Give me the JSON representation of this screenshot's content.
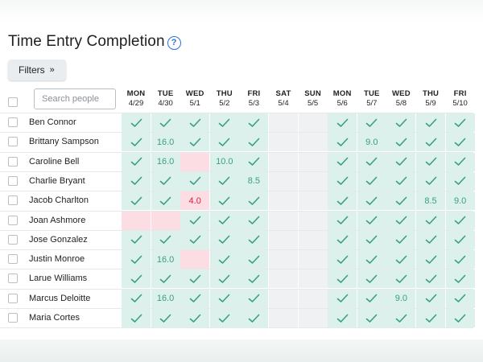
{
  "page": {
    "title": "Time Entry Completion",
    "help": "?",
    "filters_label": "Filters",
    "filters_chevron": "»",
    "search_placeholder": "Search people"
  },
  "colors": {
    "complete": "#ddf1ec",
    "check": "#3a9d84",
    "missing": "#fbdde3",
    "missing_text": "#d0223f",
    "weekend": "#f0f1f2",
    "accent": "#2f6fd6"
  },
  "days": [
    {
      "name": "MON",
      "date": "4/29",
      "weekend": false
    },
    {
      "name": "TUE",
      "date": "4/30",
      "weekend": false
    },
    {
      "name": "WED",
      "date": "5/1",
      "weekend": false
    },
    {
      "name": "THU",
      "date": "5/2",
      "weekend": false
    },
    {
      "name": "FRI",
      "date": "5/3",
      "weekend": false
    },
    {
      "name": "SAT",
      "date": "5/4",
      "weekend": true
    },
    {
      "name": "SUN",
      "date": "5/5",
      "weekend": true
    },
    {
      "name": "MON",
      "date": "5/6",
      "weekend": false
    },
    {
      "name": "TUE",
      "date": "5/7",
      "weekend": false
    },
    {
      "name": "WED",
      "date": "5/8",
      "weekend": false
    },
    {
      "name": "THU",
      "date": "5/9",
      "weekend": false
    },
    {
      "name": "FRI",
      "date": "5/10",
      "weekend": false
    }
  ],
  "people": [
    {
      "name": "Ben Connor",
      "cells": [
        "c",
        "c",
        "c",
        "c",
        "c",
        "-",
        "-",
        "c",
        "c",
        "c",
        "c",
        "c"
      ]
    },
    {
      "name": "Brittany Sampson",
      "cells": [
        "c",
        "16.0",
        "c",
        "c",
        "c",
        "-",
        "-",
        "c",
        "9.0",
        "c",
        "c",
        "c"
      ]
    },
    {
      "name": "Caroline Bell",
      "cells": [
        "c",
        "16.0",
        "x",
        "10.0",
        "c",
        "-",
        "-",
        "c",
        "c",
        "c",
        "c",
        "c"
      ]
    },
    {
      "name": "Charlie Bryant",
      "cells": [
        "c",
        "c",
        "c",
        "c",
        "8.5",
        "-",
        "-",
        "c",
        "c",
        "c",
        "c",
        "c"
      ]
    },
    {
      "name": "Jacob Charlton",
      "cells": [
        "c",
        "c",
        "x:4.0",
        "c",
        "c",
        "-",
        "-",
        "c",
        "c",
        "c",
        "8.5",
        "9.0"
      ]
    },
    {
      "name": "Joan Ashmore",
      "cells": [
        "x",
        "x",
        "c",
        "c",
        "c",
        "-",
        "-",
        "c",
        "c",
        "c",
        "c",
        "c"
      ]
    },
    {
      "name": "Jose Gonzalez",
      "cells": [
        "c",
        "c",
        "c",
        "c",
        "c",
        "-",
        "-",
        "c",
        "c",
        "c",
        "c",
        "c"
      ]
    },
    {
      "name": "Justin Monroe",
      "cells": [
        "c",
        "16.0",
        "x",
        "c",
        "c",
        "-",
        "-",
        "c",
        "c",
        "c",
        "c",
        "c"
      ]
    },
    {
      "name": "Larue Williams",
      "cells": [
        "c",
        "c",
        "c",
        "c",
        "c",
        "-",
        "-",
        "c",
        "c",
        "c",
        "c",
        "c"
      ]
    },
    {
      "name": "Marcus Deloitte",
      "cells": [
        "c",
        "16.0",
        "c",
        "c",
        "c",
        "-",
        "-",
        "c",
        "c",
        "9.0",
        "c",
        "c"
      ]
    },
    {
      "name": "Maria Cortes",
      "cells": [
        "c",
        "c",
        "c",
        "c",
        "c",
        "-",
        "-",
        "c",
        "c",
        "c",
        "c",
        "c"
      ]
    }
  ]
}
